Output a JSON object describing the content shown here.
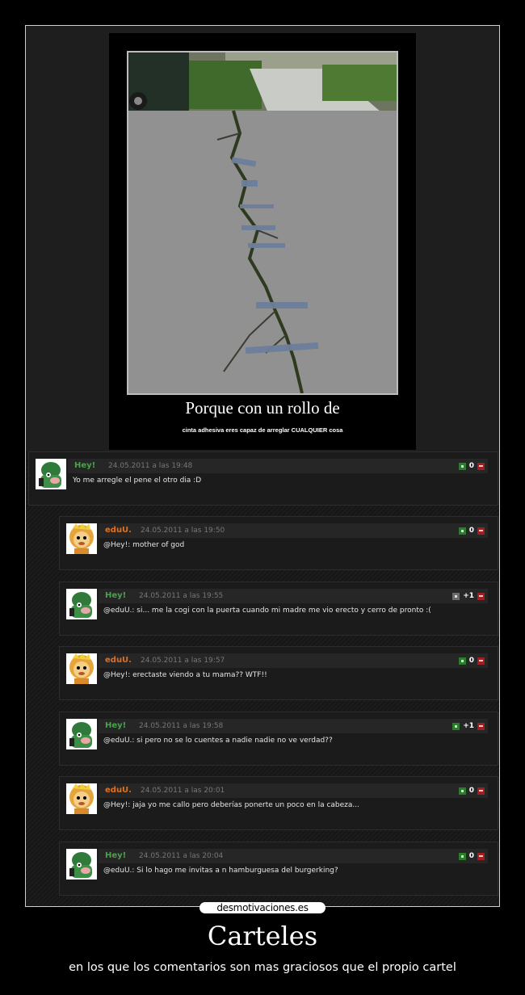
{
  "poster": {
    "title": "Porque con un rollo de",
    "subtitle": "cinta adhesiva eres capaz de arreglar  CUALQUIER cosa"
  },
  "comments": [
    {
      "user": "Hey!",
      "date": "24.05.2011 a las 19:48",
      "text": "Yo me arregle el pene el otro dia :D",
      "score": "0",
      "avatar": "green-character",
      "reply": false
    },
    {
      "user": "eduU.",
      "date": "24.05.2011 a las 19:50",
      "text": "@Hey!: mother of god",
      "score": "0",
      "avatar": "lion-character",
      "reply": true
    },
    {
      "user": "Hey!",
      "date": "24.05.2011 a las 19:55",
      "text": "@eduU.: si... me la cogi con la puerta cuando mi madre me vio erecto y cerro de pronto :(",
      "score": "+1",
      "avatar": "green-character",
      "reply": true
    },
    {
      "user": "eduU.",
      "date": "24.05.2011 a las 19:57",
      "text": "@Hey!: erectaste viendo a tu mama?? WTF!!",
      "score": "0",
      "avatar": "lion-character",
      "reply": true
    },
    {
      "user": "Hey!",
      "date": "24.05.2011 a las 19:58",
      "text": "@eduU.: si pero no se lo cuentes a nadie nadie no ve verdad??",
      "score": "+1",
      "avatar": "green-character",
      "reply": true
    },
    {
      "user": "eduU.",
      "date": "24.05.2011 a las 20:01",
      "text": "@Hey!: jaja yo me callo pero deberías ponerte un poco en la cabeza...",
      "score": "0",
      "avatar": "lion-character",
      "reply": true
    },
    {
      "user": "Hey!",
      "date": "24.05.2011 a las 20:04",
      "text": "@eduU.: Si lo hago me invitas a n hamburguesa del burgerking?",
      "score": "0",
      "avatar": "green-character",
      "reply": true
    }
  ],
  "site_logo": "desmotivaciones.es",
  "caption": {
    "title": "Carteles",
    "subtitle": "en los que los comentarios son mas graciosos que el propio cartel"
  },
  "colors": {
    "user_green": "#49a34a",
    "user_orange": "#e0701f",
    "vote_up": "#2b7d2b",
    "vote_down": "#a31d1d"
  }
}
